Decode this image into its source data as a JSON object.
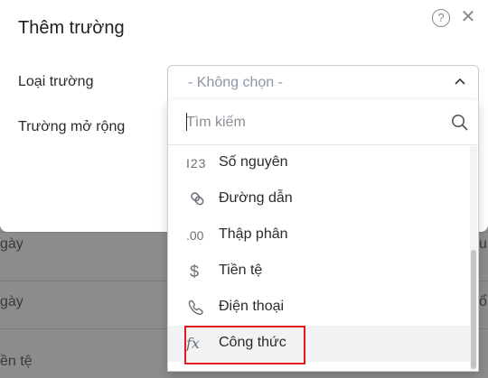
{
  "dialog": {
    "title": "Thêm trường",
    "help_icon": "question-circle-icon",
    "close_icon": "close-icon"
  },
  "fields": {
    "field_type_label": "Loại trường",
    "extended_field_label": "Trường mở rộng",
    "field_type_value": "- Không chọn -"
  },
  "dropdown": {
    "search_placeholder": "Tìm kiếm",
    "items": [
      {
        "label": "Số nguyên",
        "icon": "integer-icon",
        "glyph": "I23"
      },
      {
        "label": "Đường dẫn",
        "icon": "link-icon",
        "glyph": ""
      },
      {
        "label": "Thập phân",
        "icon": "decimal-icon",
        "glyph": ".00"
      },
      {
        "label": "Tiền tệ",
        "icon": "dollar-icon",
        "glyph": "$"
      },
      {
        "label": "Điện thoại",
        "icon": "phone-icon",
        "glyph": ""
      },
      {
        "label": "Công thức",
        "icon": "formula-icon",
        "glyph": "fx"
      }
    ],
    "highlighted_item": "Công thức"
  },
  "background": {
    "row_labels": [
      "gày",
      "gày",
      "ền tệ"
    ],
    "right_fragments": [
      "u",
      "ổ"
    ]
  }
}
